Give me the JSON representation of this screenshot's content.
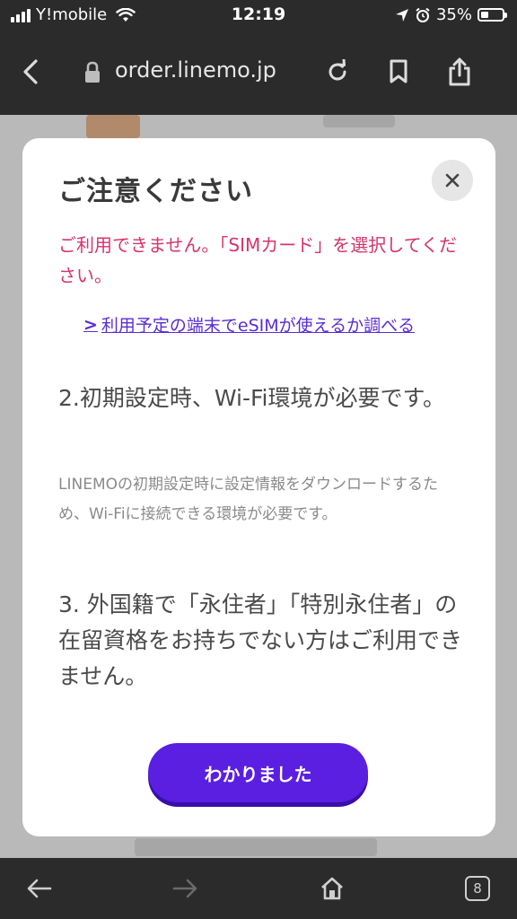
{
  "status_bar": {
    "carrier": "Y!mobile",
    "time": "12:19",
    "battery_percent": "35%",
    "battery_level": 0.35,
    "icons": [
      "signal-icon",
      "wifi-icon",
      "location-icon",
      "alarm-icon",
      "battery-icon"
    ]
  },
  "browser": {
    "url": "order.linemo.jp",
    "icons": [
      "back-icon",
      "lock-icon",
      "reload-icon",
      "bookmark-icon",
      "share-icon"
    ],
    "tabs_count": "8"
  },
  "modal": {
    "title": "ご注意ください",
    "warning": "ご利用できません。「SIMカード」を選択してください。",
    "link_label": "利用予定の端末でeSIMが使えるか調べる",
    "section2_title": "2.初期設定時、Wi-Fi環境が必要です。",
    "section2_body": "LINEMOの初期設定時に設定情報をダウンロードするため、Wi-Fiに接続できる環境が必要です。",
    "section3_title": "3. 外国籍で「永住者」「特別永住者」の在留資格をお持ちでない方はご利用できません。",
    "button_label": "わかりました"
  },
  "colors": {
    "accent": "#5a1fe0",
    "warning": "#d6336c",
    "link": "#5a2cd6"
  }
}
